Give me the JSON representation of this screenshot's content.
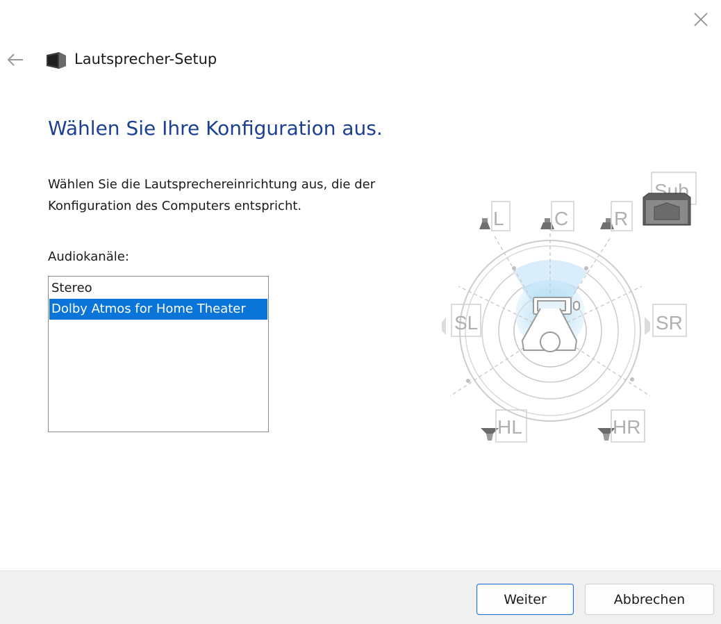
{
  "window": {
    "title": "Lautsprecher-Setup",
    "back_icon": "arrow-left-icon",
    "close_icon": "close-icon",
    "app_icon": "speaker-icon"
  },
  "main": {
    "heading": "Wählen Sie Ihre Konfiguration aus.",
    "description": "Wählen Sie die Lautsprechereinrichtung aus, die der Konfiguration des Computers entspricht.",
    "list_label": "Audiokanäle:",
    "channels": [
      {
        "label": "Stereo",
        "selected": false
      },
      {
        "label": "Dolby Atmos for Home Theater",
        "selected": true
      }
    ]
  },
  "diagram": {
    "speakers": {
      "sub": "Sub",
      "left": "L",
      "center": "C",
      "right": "R",
      "side_left": "SL",
      "side_right": "SR",
      "height_left": "HL",
      "height_right": "HR"
    }
  },
  "footer": {
    "next_label": "Weiter",
    "cancel_label": "Abbrechen"
  },
  "colors": {
    "heading": "#1b3f91",
    "selection": "#0a74d8",
    "footer_bg": "#f0f0f0",
    "sound_field": "#7cc4ee"
  }
}
